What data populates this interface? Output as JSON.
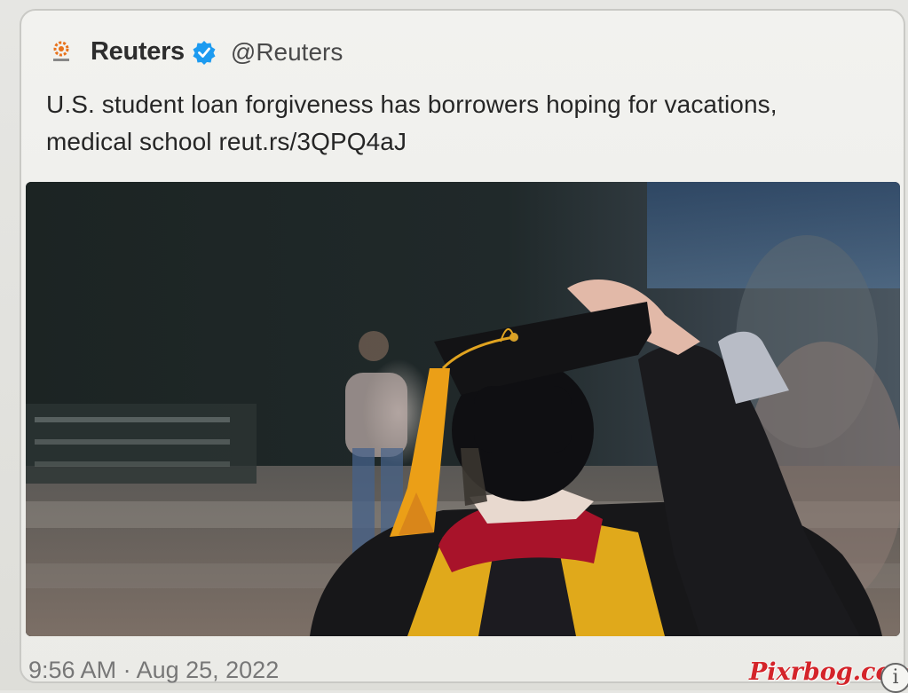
{
  "tweet": {
    "author_name": "Reuters",
    "handle": "@Reuters",
    "text_line1": "U.S. student loan forgiveness has borrowers hoping for vacations,",
    "text_line2": "medical school reut.rs/3QPQ4aJ",
    "timestamp": "9:56 AM · Aug 25, 2022",
    "image_alt": "Graduate in cap and gown holding cap on head"
  },
  "icons": {
    "logo": "reuters-logo-icon",
    "verified": "verified-badge-icon",
    "info": "info-icon"
  },
  "watermark": "Pixrbog.com",
  "colors": {
    "verified_blue": "#1d9bf0",
    "watermark_red": "#d4242a",
    "tassel_gold": "#f0a31c",
    "hood_red": "#a8132a"
  }
}
